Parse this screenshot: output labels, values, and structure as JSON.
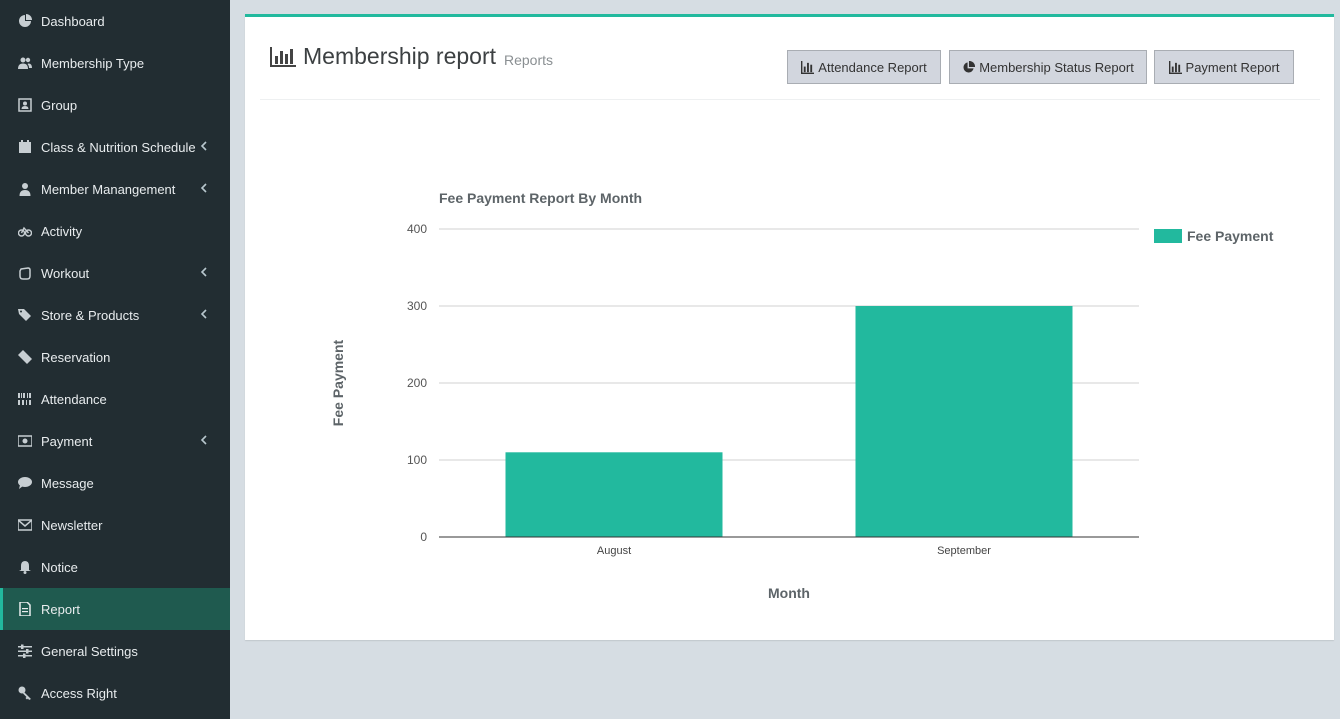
{
  "sidebar": {
    "items": [
      {
        "label": "Dashboard",
        "icon": "dashboard-icon",
        "has_chevron": false
      },
      {
        "label": "Membership Type",
        "icon": "users-icon",
        "has_chevron": false
      },
      {
        "label": "Group",
        "icon": "group-icon",
        "has_chevron": false
      },
      {
        "label": "Class & Nutrition Schedule",
        "icon": "calendar-icon",
        "has_chevron": true
      },
      {
        "label": "Member Manangement",
        "icon": "user-icon",
        "has_chevron": true
      },
      {
        "label": "Activity",
        "icon": "bicycle-icon",
        "has_chevron": false
      },
      {
        "label": "Workout",
        "icon": "hand-icon",
        "has_chevron": true
      },
      {
        "label": "Store & Products",
        "icon": "tags-icon",
        "has_chevron": true
      },
      {
        "label": "Reservation",
        "icon": "ticket-icon",
        "has_chevron": false
      },
      {
        "label": "Attendance",
        "icon": "barcode-icon",
        "has_chevron": false
      },
      {
        "label": "Payment",
        "icon": "money-icon",
        "has_chevron": true
      },
      {
        "label": "Message",
        "icon": "comment-icon",
        "has_chevron": false
      },
      {
        "label": "Newsletter",
        "icon": "envelope-icon",
        "has_chevron": false
      },
      {
        "label": "Notice",
        "icon": "bell-icon",
        "has_chevron": false
      },
      {
        "label": "Report",
        "icon": "file-icon",
        "has_chevron": false,
        "active": true
      },
      {
        "label": "General Settings",
        "icon": "sliders-icon",
        "has_chevron": false
      },
      {
        "label": "Access Right",
        "icon": "key-icon",
        "has_chevron": false
      }
    ]
  },
  "header": {
    "title": "Membership report",
    "subtitle": "Reports",
    "title_icon": "bar-chart-icon"
  },
  "buttons": {
    "attendance": "Attendance Report",
    "membership_status": "Membership Status Report",
    "payment": "Payment Report"
  },
  "colors": {
    "accent": "#22b99e",
    "sidebar_bg": "#222d32",
    "active_item_bg": "#1f5a4f",
    "page_bg": "#d6dde3"
  },
  "chart_data": {
    "type": "bar",
    "title": "Fee Payment Report By Month",
    "xlabel": "Month",
    "ylabel": "Fee Payment",
    "categories": [
      "August",
      "September"
    ],
    "series": [
      {
        "name": "Fee Payment",
        "values": [
          110,
          300
        ],
        "color": "#22b99e"
      }
    ],
    "ylim": [
      0,
      400
    ],
    "yticks": [
      0,
      100,
      200,
      300,
      400
    ],
    "grid": true,
    "legend": "right"
  }
}
